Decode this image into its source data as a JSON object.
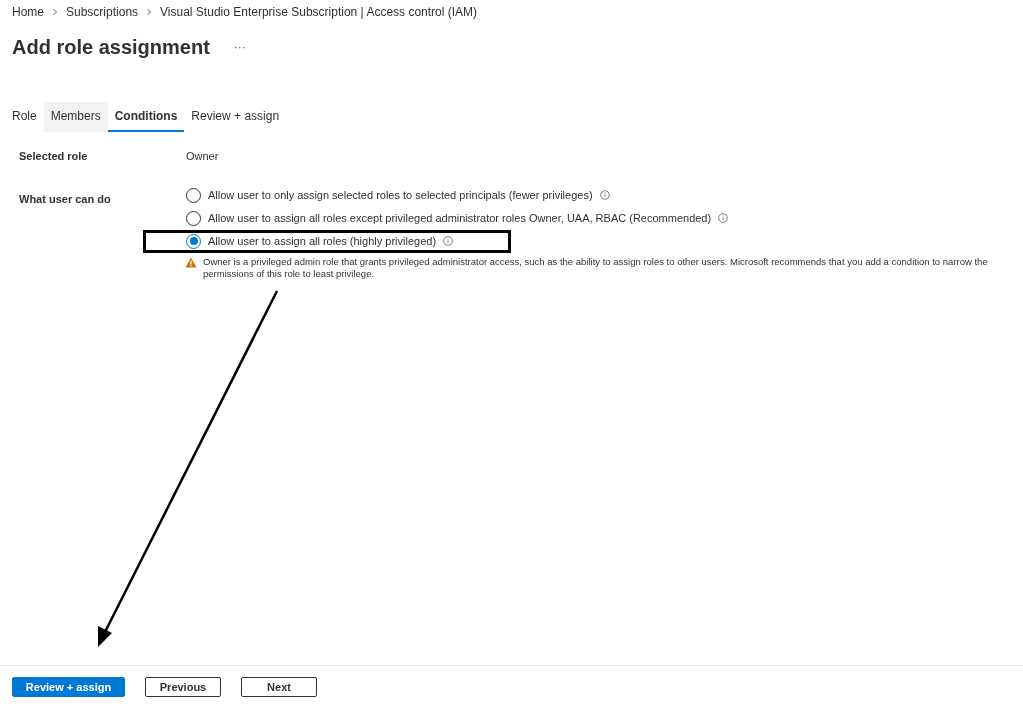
{
  "breadcrumb": [
    "Home",
    "Subscriptions",
    "Visual Studio Enterprise Subscription | Access control (IAM)"
  ],
  "title": "Add role assignment",
  "more": "···",
  "tabs": [
    {
      "label": "Role",
      "selected": false,
      "hovered": false
    },
    {
      "label": "Members",
      "selected": false,
      "hovered": true
    },
    {
      "label": "Conditions",
      "selected": true,
      "hovered": false
    },
    {
      "label": "Review + assign",
      "selected": false,
      "hovered": false
    }
  ],
  "selected_role": {
    "label": "Selected role",
    "value": "Owner"
  },
  "what_user_can_do": {
    "label": "What user can do",
    "options": [
      {
        "label": "Allow user to only assign selected roles to selected principals (fewer privileges)",
        "selected": false,
        "highlighted": false
      },
      {
        "label": "Allow user to assign all roles except privileged administrator roles Owner, UAA, RBAC (Recommended)",
        "selected": false,
        "highlighted": false
      },
      {
        "label": "Allow user to assign all roles (highly privileged)",
        "selected": true,
        "highlighted": true
      }
    ],
    "warning": "Owner is a privileged admin role that grants privileged administrator access, such as the ability to assign roles to other users. Microsoft recommends that you add a condition to narrow the permissions of this role to least privilege."
  },
  "buttons": [
    {
      "label": "Review + assign",
      "kind": "primary"
    },
    {
      "label": "Previous",
      "kind": "secondary"
    },
    {
      "label": "Next",
      "kind": "secondary"
    }
  ]
}
